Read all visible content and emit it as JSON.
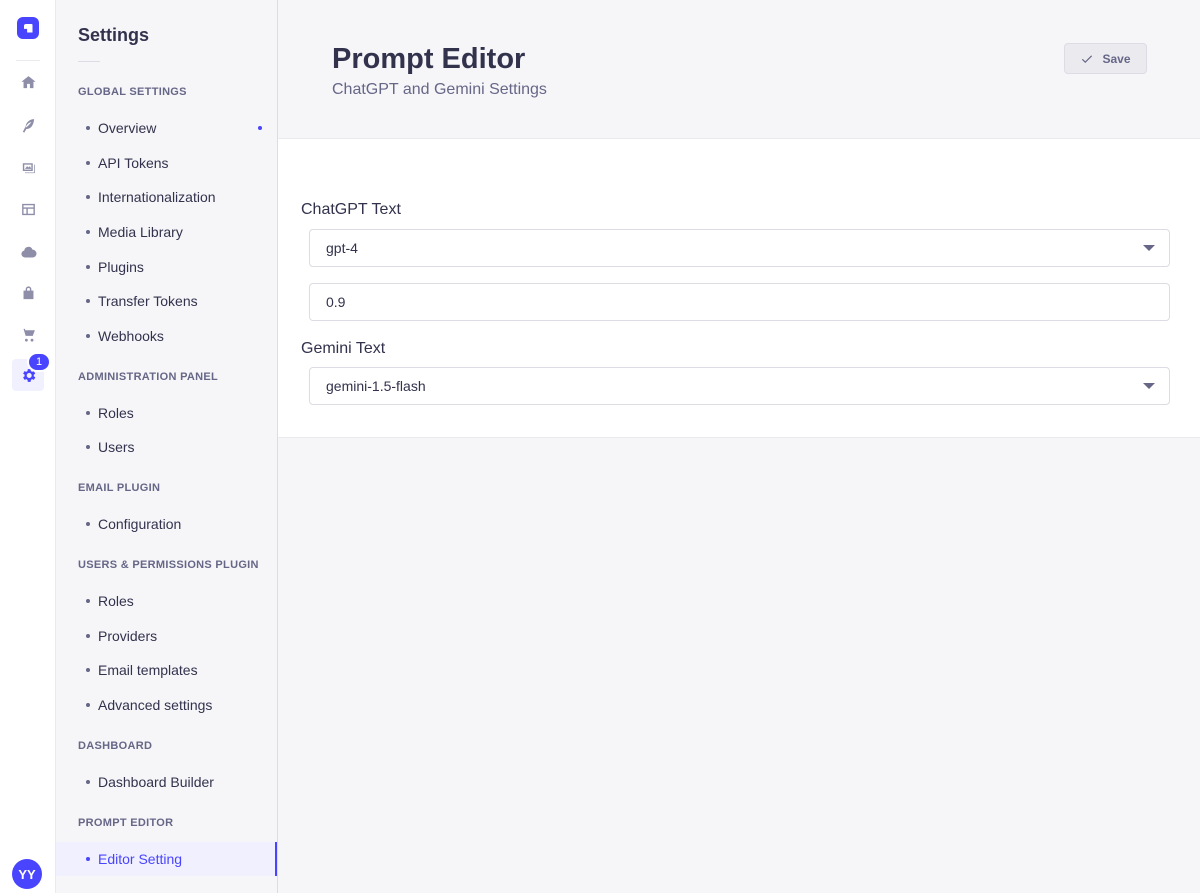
{
  "rail": {
    "items": [
      {
        "icon": "home-icon"
      },
      {
        "icon": "feather-icon"
      },
      {
        "icon": "media-icon"
      },
      {
        "icon": "layout-icon"
      },
      {
        "icon": "cloud-icon"
      },
      {
        "icon": "bag-icon"
      },
      {
        "icon": "cart-icon"
      },
      {
        "icon": "gear-icon",
        "active": true
      }
    ],
    "badge": "1",
    "avatar": "YY"
  },
  "subnav": {
    "title": "Settings",
    "sections": [
      {
        "label": "GLOBAL SETTINGS",
        "items": [
          "Overview",
          "API Tokens",
          "Internationalization",
          "Media Library",
          "Plugins",
          "Transfer Tokens",
          "Webhooks"
        ]
      },
      {
        "label": "ADMINISTRATION PANEL",
        "items": [
          "Roles",
          "Users"
        ]
      },
      {
        "label": "EMAIL PLUGIN",
        "items": [
          "Configuration"
        ]
      },
      {
        "label": "USERS & PERMISSIONS PLUGIN",
        "items": [
          "Roles",
          "Providers",
          "Email templates",
          "Advanced settings"
        ]
      },
      {
        "label": "DASHBOARD",
        "items": [
          "Dashboard Builder"
        ]
      },
      {
        "label": "PROMPT EDITOR",
        "items": [
          "Editor Setting"
        ]
      }
    ],
    "active_item": "Editor Setting"
  },
  "header": {
    "title": "Prompt Editor",
    "subtitle": "ChatGPT and Gemini Settings",
    "save_label": "Save"
  },
  "form": {
    "chatgpt_label": "ChatGPT Text",
    "chatgpt_model": "gpt-4",
    "chatgpt_temperature": "0.9",
    "gemini_label": "Gemini Text",
    "gemini_model": "gemini-1.5-flash"
  },
  "colors": {
    "accent": "#4945ff",
    "text": "#32324d",
    "muted": "#666687"
  }
}
